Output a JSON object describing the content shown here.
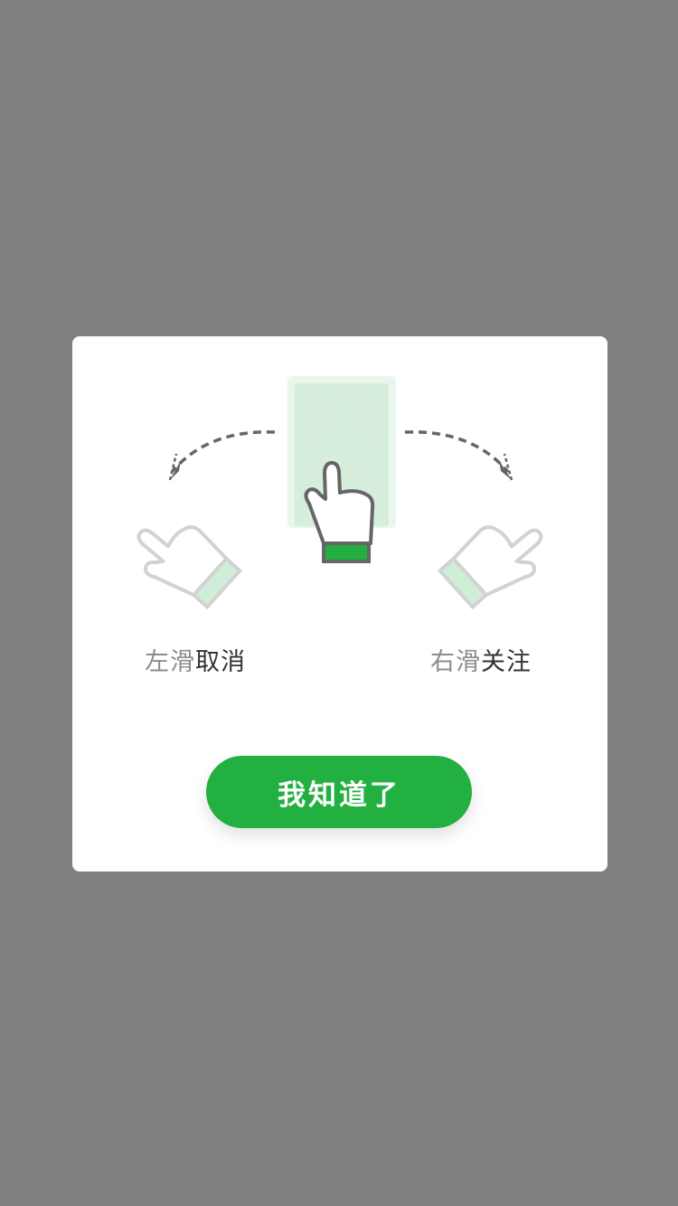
{
  "colors": {
    "overlay": "#808080",
    "modal_background": "#ffffff",
    "accent": "#22b041",
    "card_fill": "#d6eedb",
    "arrow": "#666666",
    "muted_text": "#8c8c8c",
    "strong_text": "#333333"
  },
  "guide": {
    "left_hint": {
      "prefix": "左滑",
      "action": "取消"
    },
    "right_hint": {
      "prefix": "右滑",
      "action": "关注"
    },
    "icons": [
      "card-icon",
      "hand-pointer-up-icon",
      "hand-pointer-left-icon",
      "hand-pointer-right-icon",
      "dashed-arrow-left-icon",
      "dashed-arrow-right-icon"
    ]
  },
  "confirm_button": {
    "label": "我知道了"
  }
}
